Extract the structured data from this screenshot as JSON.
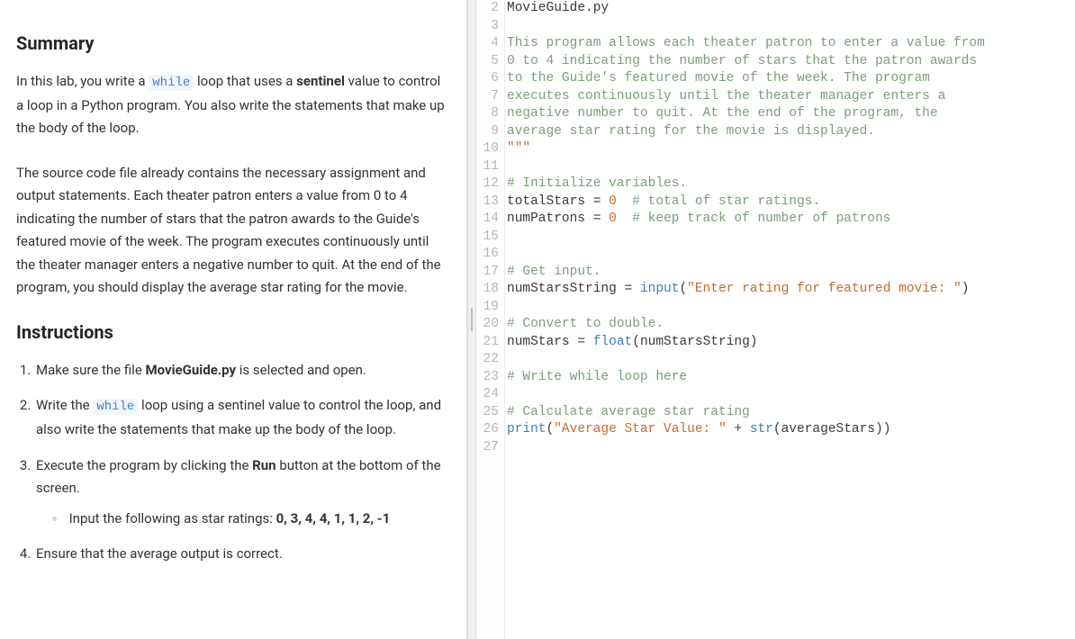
{
  "left": {
    "summary_heading": "Summary",
    "summary_p1_a": "In this lab, you write a ",
    "summary_p1_code": "while",
    "summary_p1_b": " loop that uses a ",
    "summary_p1_bold": "sentinel",
    "summary_p1_c": " value to control a loop in a Python program. You also write the statements that make up the body of the loop.",
    "summary_p2": "The source code file already contains the necessary assignment and output statements. Each theater patron enters a value from 0 to 4 indicating the number of stars that the patron awards to the Guide's featured movie of the week. The program executes continuously until the theater manager enters a negative number to quit. At the end of the program, you should display the average star rating for the movie.",
    "instructions_heading": "Instructions",
    "step1_a": "Make sure the file ",
    "step1_bold": "MovieGuide.py",
    "step1_b": " is selected and open.",
    "step2_a": "Write the ",
    "step2_code": "while",
    "step2_b": " loop using a sentinel value to control the loop, and also write the statements that make up the body of the loop.",
    "step3_a": "Execute the program by clicking the ",
    "step3_bold": "Run",
    "step3_b": " button at the bottom of the screen.",
    "step3_sub_a": "Input the following as star ratings: ",
    "step3_sub_bold": "0, 3, 4, 4, 1, 1, 2, -1",
    "step4": "Ensure that the average output is correct."
  },
  "code": {
    "lines": [
      {
        "n": 2,
        "tokens": [
          [
            "ident",
            "MovieGuide.py"
          ]
        ]
      },
      {
        "n": 3,
        "tokens": []
      },
      {
        "n": 4,
        "tokens": [
          [
            "comment",
            "This program allows each theater patron to enter a value from"
          ]
        ]
      },
      {
        "n": 5,
        "tokens": [
          [
            "comment",
            "0 to 4 indicating the number of stars that the patron awards"
          ]
        ]
      },
      {
        "n": 6,
        "tokens": [
          [
            "comment",
            "to the Guide's featured movie of the week. The program"
          ]
        ]
      },
      {
        "n": 7,
        "tokens": [
          [
            "comment",
            "executes continuously until the theater manager enters a"
          ]
        ]
      },
      {
        "n": 8,
        "tokens": [
          [
            "comment",
            "negative number to quit. At the end of the program, the"
          ]
        ]
      },
      {
        "n": 9,
        "tokens": [
          [
            "comment",
            "average star rating for the movie is displayed."
          ]
        ]
      },
      {
        "n": 10,
        "tokens": [
          [
            "string",
            "\"\"\""
          ]
        ]
      },
      {
        "n": 11,
        "tokens": []
      },
      {
        "n": 12,
        "tokens": [
          [
            "comment",
            "# Initialize variables."
          ]
        ]
      },
      {
        "n": 13,
        "tokens": [
          [
            "ident",
            "totalStars "
          ],
          [
            "op",
            "= "
          ],
          [
            "number",
            "0"
          ],
          [
            "ident",
            "  "
          ],
          [
            "comment",
            "# total of star ratings."
          ]
        ]
      },
      {
        "n": 14,
        "tokens": [
          [
            "ident",
            "numPatrons "
          ],
          [
            "op",
            "= "
          ],
          [
            "number",
            "0"
          ],
          [
            "ident",
            "  "
          ],
          [
            "comment",
            "# keep track of number of patrons"
          ]
        ]
      },
      {
        "n": 15,
        "tokens": []
      },
      {
        "n": 16,
        "tokens": []
      },
      {
        "n": 17,
        "tokens": [
          [
            "comment",
            "# Get input."
          ]
        ]
      },
      {
        "n": 18,
        "tokens": [
          [
            "ident",
            "numStarsString "
          ],
          [
            "op",
            "= "
          ],
          [
            "func",
            "input"
          ],
          [
            "op",
            "("
          ],
          [
            "string",
            "\"Enter rating for featured movie: \""
          ],
          [
            "op",
            ")"
          ]
        ]
      },
      {
        "n": 19,
        "tokens": []
      },
      {
        "n": 20,
        "tokens": [
          [
            "comment",
            "# Convert to double."
          ]
        ]
      },
      {
        "n": 21,
        "tokens": [
          [
            "ident",
            "numStars "
          ],
          [
            "op",
            "= "
          ],
          [
            "func",
            "float"
          ],
          [
            "op",
            "("
          ],
          [
            "ident",
            "numStarsString"
          ],
          [
            "op",
            ")"
          ]
        ]
      },
      {
        "n": 22,
        "tokens": []
      },
      {
        "n": 23,
        "tokens": [
          [
            "comment",
            "# Write while loop here"
          ]
        ]
      },
      {
        "n": 24,
        "tokens": []
      },
      {
        "n": 25,
        "tokens": [
          [
            "comment",
            "# Calculate average star rating"
          ]
        ]
      },
      {
        "n": 26,
        "tokens": [
          [
            "func",
            "print"
          ],
          [
            "op",
            "("
          ],
          [
            "string",
            "\"Average Star Value: \""
          ],
          [
            "op",
            " + "
          ],
          [
            "func",
            "str"
          ],
          [
            "op",
            "("
          ],
          [
            "ident",
            "averageStars"
          ],
          [
            "op",
            "))"
          ]
        ]
      },
      {
        "n": 27,
        "tokens": []
      }
    ]
  }
}
